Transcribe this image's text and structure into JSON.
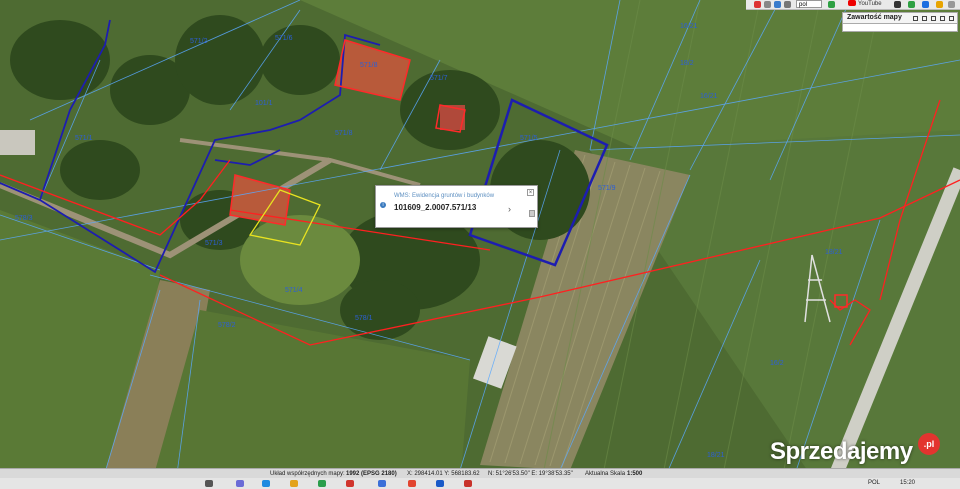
{
  "map": {
    "parcel_labels": [
      "571/8",
      "571/6",
      "571/8",
      "571/7",
      "571/5",
      "571/9",
      "571/4",
      "571/3",
      "571/2",
      "571/1",
      "578/1",
      "578/2",
      "578/3",
      "101/1",
      "16/21",
      "16/21",
      "18/2",
      "18/21",
      "16/2",
      "18/21"
    ],
    "colors": {
      "parcel_line": "#5aa9ff",
      "boundary_red": "#ff2020",
      "highlight_blue": "#1d1db0",
      "building_red": "#ff2a2a",
      "fence_yellow": "#e9e320"
    }
  },
  "toolbar": {
    "lang_select": "pol",
    "youtube_label": "YouTube",
    "content_button_label": "Zawartość mapy",
    "icons": [
      "home-icon",
      "print-icon",
      "layers-icon",
      "fullscreen-icon",
      "help-icon",
      "settings-icon"
    ]
  },
  "popup": {
    "source": "WMS: Ewidencja gruntów i budynków",
    "parcel_id": "101609_2.0007.571/13",
    "close": "×",
    "next": "›",
    "info": "i"
  },
  "status": {
    "crs_prefix": "Układ współrzędnych mapy:",
    "crs": "1992 (EPSG 2180)",
    "coords": "X: 298414.01 Y: 568183.62",
    "geo": "N: 51°26'53.50\" E: 19°38'53.35\"",
    "scale_prefix": "Aktualna Skala",
    "scale": "1:500"
  },
  "taskbar": {
    "lang": "POL",
    "time": "15:20"
  },
  "watermark": {
    "text": "Sprzedajemy",
    "suffix": ".pl"
  }
}
